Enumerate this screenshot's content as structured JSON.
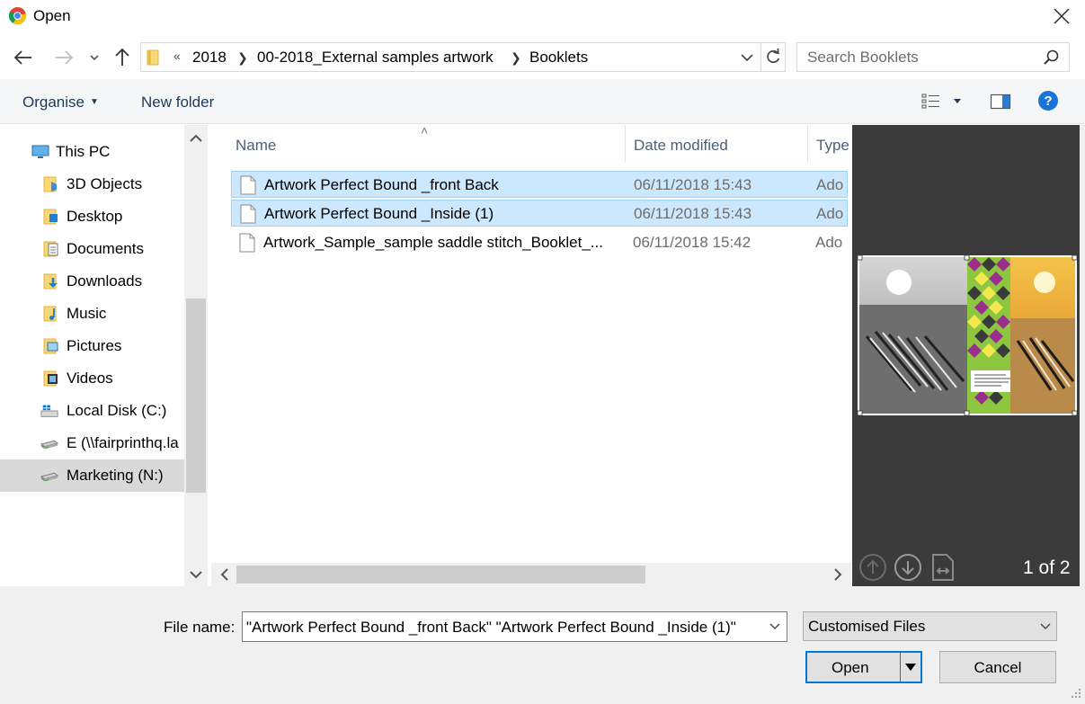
{
  "window": {
    "title": "Open",
    "icon": "chrome-icon"
  },
  "nav": {
    "back": "back-arrow-icon",
    "forward": "forward-arrow-icon",
    "recent": "chevron-down-icon",
    "up": "up-arrow-icon"
  },
  "address": {
    "overflow": "«",
    "crumbs": [
      "2018",
      "00-2018_External samples artwork",
      "Booklets"
    ]
  },
  "search": {
    "placeholder": "Search Booklets"
  },
  "toolbar": {
    "organise": "Organise",
    "new_folder": "New folder"
  },
  "sidebar": {
    "items": [
      {
        "label": "This PC",
        "icon": "computer-icon"
      },
      {
        "label": "3D Objects",
        "icon": "folder-3d-icon"
      },
      {
        "label": "Desktop",
        "icon": "folder-desktop-icon"
      },
      {
        "label": "Documents",
        "icon": "folder-documents-icon"
      },
      {
        "label": "Downloads",
        "icon": "folder-downloads-icon"
      },
      {
        "label": "Music",
        "icon": "folder-music-icon"
      },
      {
        "label": "Pictures",
        "icon": "folder-pictures-icon"
      },
      {
        "label": "Videos",
        "icon": "folder-videos-icon"
      },
      {
        "label": "Local Disk (C:)",
        "icon": "local-disk-icon"
      },
      {
        "label": "E (\\\\fairprinthq.la",
        "icon": "network-drive-icon"
      },
      {
        "label": "Marketing (N:)",
        "icon": "network-drive-icon"
      }
    ],
    "selected": "Marketing (N:)"
  },
  "columns": {
    "name": "Name",
    "date": "Date modified",
    "type": "Type"
  },
  "files": [
    {
      "name": "Artwork Perfect Bound _front Back",
      "date": "06/11/2018 15:43",
      "type": "Ado",
      "selected": true
    },
    {
      "name": "Artwork Perfect Bound _Inside (1)",
      "date": "06/11/2018 15:43",
      "type": "Ado",
      "selected": true
    },
    {
      "name": "Artwork_Sample_sample saddle stitch_Booklet_...",
      "date": "06/11/2018 15:42",
      "type": "Ado",
      "selected": false
    }
  ],
  "preview": {
    "page_count": "1 of 2"
  },
  "bottom": {
    "file_name_label": "File name:",
    "file_name_value": "\"Artwork Perfect Bound _front Back\" \"Artwork Perfect Bound _Inside (1)\"",
    "filter": "Customised Files",
    "open": "Open",
    "cancel": "Cancel"
  },
  "colors": {
    "selection_bg": "#cce8ff",
    "selection_border": "#99d1ff",
    "accent": "#0078d7",
    "preview_bg": "#3b3b3b"
  }
}
